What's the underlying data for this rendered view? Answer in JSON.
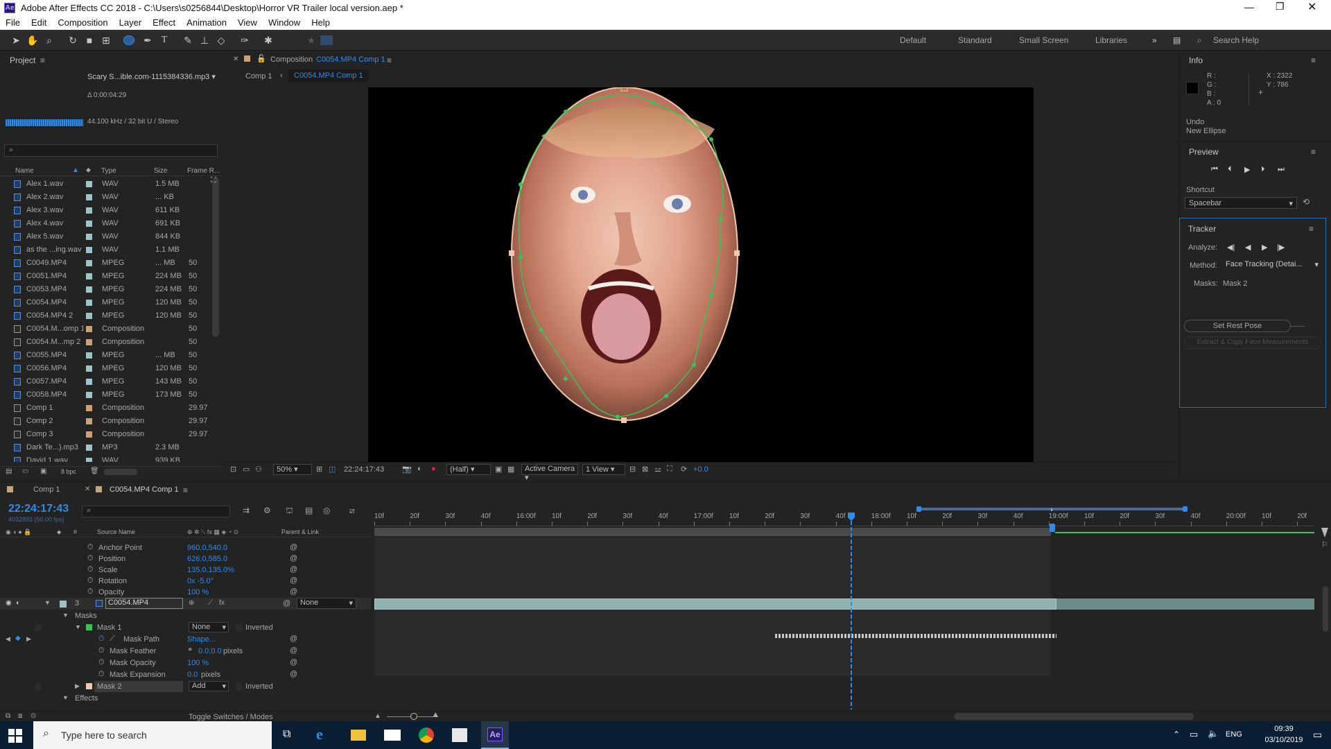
{
  "window": {
    "title": "Adobe After Effects CC 2018 - C:\\Users\\s0256844\\Desktop\\Horror VR Trailer local version.aep *"
  },
  "menu": [
    "File",
    "Edit",
    "Composition",
    "Layer",
    "Effect",
    "Animation",
    "View",
    "Window",
    "Help"
  ],
  "workspaces": [
    "Default",
    "Standard",
    "Small Screen",
    "Libraries"
  ],
  "search_help": "Search Help",
  "project": {
    "title": "Project",
    "selected_name": "Scary S...ible.com-1115384336.mp3 ▾",
    "duration": "Δ 0:00:04:29",
    "audio_info": "44.100 kHz / 32 bit U / Stereo",
    "search_placeholder": "",
    "columns": {
      "name": "Name",
      "type": "Type",
      "size": "Size",
      "frame": "Frame R..."
    },
    "items": [
      {
        "name": "Alex 1.wav",
        "type": "WAV",
        "size": "1.5 MB",
        "frame": "",
        "kind": "audio",
        "label": "#9fc4c8"
      },
      {
        "name": "Alex 2.wav",
        "type": "WAV",
        "size": "... KB",
        "frame": "",
        "kind": "audio",
        "label": "#9fc4c8"
      },
      {
        "name": "Alex 3.wav",
        "type": "WAV",
        "size": "611 KB",
        "frame": "",
        "kind": "audio",
        "label": "#9fc4c8"
      },
      {
        "name": "Alex 4.wav",
        "type": "WAV",
        "size": "691 KB",
        "frame": "",
        "kind": "audio",
        "label": "#9fc4c8"
      },
      {
        "name": "Alex 5.wav",
        "type": "WAV",
        "size": "844 KB",
        "frame": "",
        "kind": "audio",
        "label": "#9fc4c8"
      },
      {
        "name": "as the ...ing.wav",
        "type": "WAV",
        "size": "1.1 MB",
        "frame": "",
        "kind": "audio",
        "label": "#9fc4c8"
      },
      {
        "name": "C0049.MP4",
        "type": "MPEG",
        "size": "... MB",
        "frame": "50",
        "kind": "video",
        "label": "#9fc4c8"
      },
      {
        "name": "C0051.MP4",
        "type": "MPEG",
        "size": "224 MB",
        "frame": "50",
        "kind": "video",
        "label": "#9fc4c8"
      },
      {
        "name": "C0053.MP4",
        "type": "MPEG",
        "size": "224 MB",
        "frame": "50",
        "kind": "video",
        "label": "#9fc4c8"
      },
      {
        "name": "C0054.MP4",
        "type": "MPEG",
        "size": "120 MB",
        "frame": "50",
        "kind": "video",
        "label": "#9fc4c8"
      },
      {
        "name": "C0054.MP4 2",
        "type": "MPEG",
        "size": "120 MB",
        "frame": "50",
        "kind": "video",
        "label": "#9fc4c8"
      },
      {
        "name": "C0054.M...omp 1",
        "type": "Composition",
        "size": "",
        "frame": "50",
        "kind": "comp",
        "label": "#c8a27a"
      },
      {
        "name": "C0054.M...mp 2",
        "type": "Composition",
        "size": "",
        "frame": "50",
        "kind": "comp",
        "label": "#c8a27a"
      },
      {
        "name": "C0055.MP4",
        "type": "MPEG",
        "size": "... MB",
        "frame": "50",
        "kind": "video",
        "label": "#9fc4c8"
      },
      {
        "name": "C0056.MP4",
        "type": "MPEG",
        "size": "120 MB",
        "frame": "50",
        "kind": "video",
        "label": "#9fc4c8"
      },
      {
        "name": "C0057.MP4",
        "type": "MPEG",
        "size": "143 MB",
        "frame": "50",
        "kind": "video",
        "label": "#9fc4c8"
      },
      {
        "name": "C0058.MP4",
        "type": "MPEG",
        "size": "173 MB",
        "frame": "50",
        "kind": "video",
        "label": "#9fc4c8"
      },
      {
        "name": "Comp 1",
        "type": "Composition",
        "size": "",
        "frame": "29.97",
        "kind": "comp",
        "label": "#c8a27a"
      },
      {
        "name": "Comp 2",
        "type": "Composition",
        "size": "",
        "frame": "29.97",
        "kind": "comp",
        "label": "#c8a27a"
      },
      {
        "name": "Comp 3",
        "type": "Composition",
        "size": "",
        "frame": "29.97",
        "kind": "comp",
        "label": "#c8a27a"
      },
      {
        "name": "Dark Te...).mp3",
        "type": "MP3",
        "size": "2.3 MB",
        "frame": "",
        "kind": "audio",
        "label": "#9fc4c8"
      },
      {
        "name": "David 1.wav",
        "type": "WAV",
        "size": "939 KB",
        "frame": "",
        "kind": "audio",
        "label": "#9fc4c8"
      }
    ],
    "bpc": "8 bpc"
  },
  "composition": {
    "panel_label": "Composition",
    "panel_name": "C0054.MP4 Comp 1",
    "breadcrumbs": [
      "Comp 1",
      "C0054.MP4 Comp 1"
    ],
    "zoom": "50%",
    "timecode": "22:24:17:43",
    "resolution": "(Half)",
    "camera": "Active Camera",
    "views": "1 View",
    "exposure": "+0.0"
  },
  "info": {
    "title": "Info",
    "r": "R :",
    "g": "G :",
    "b": "B :",
    "a": "A : 0",
    "x": "X : 2322",
    "y": "Y : 786",
    "undo_label": "Undo",
    "undo_value": "New Ellipse"
  },
  "preview": {
    "title": "Preview",
    "shortcut_label": "Shortcut",
    "shortcut_value": "Spacebar"
  },
  "tracker": {
    "title": "Tracker",
    "analyze_label": "Analyze:",
    "method_label": "Method:",
    "method_value": "Face Tracking (Detai...",
    "masks_label": "Masks:",
    "masks_value": "Mask 2",
    "set_rest_pose": "Set Rest Pose",
    "extract": "Extract & Copy Face Measurements"
  },
  "timeline": {
    "tabs": [
      "Comp 1",
      "C0054.MP4 Comp 1"
    ],
    "timecode": "22:24:17:43",
    "frames": "4032893 (50.00 fps)",
    "col_source": "Source Name",
    "col_parent": "Parent & Link",
    "ruler": [
      "10f",
      "20f",
      "30f",
      "40f",
      "16:00f",
      "10f",
      "20f",
      "30f",
      "40f",
      "17:00f",
      "10f",
      "20f",
      "30f",
      "40f",
      "18:00f",
      "10f",
      "20f",
      "30f",
      "40f",
      "19:00f",
      "10f",
      "20f",
      "30f",
      "40f",
      "20:00f",
      "10f",
      "20f"
    ],
    "props": [
      {
        "name": "Anchor Point",
        "value": "960.0,540.0"
      },
      {
        "name": "Position",
        "value": "626.0,585.0"
      },
      {
        "name": "Scale",
        "value": "135.0,135.0%"
      },
      {
        "name": "Rotation",
        "value": "0x -5.0°"
      },
      {
        "name": "Opacity",
        "value": "100 %"
      }
    ],
    "layer": {
      "index": "3",
      "name": "C0054.MP4",
      "parent": "None"
    },
    "masks_group": "Masks",
    "mask1": {
      "name": "Mask 1",
      "mode": "None",
      "inverted": "Inverted"
    },
    "mask_props": [
      {
        "name": "Mask Path",
        "value": "Shape...",
        "unit": ""
      },
      {
        "name": "Mask Feather",
        "value": "0.0,0.0",
        "unit": "pixels"
      },
      {
        "name": "Mask Opacity",
        "value": "100 %",
        "unit": ""
      },
      {
        "name": "Mask Expansion",
        "value": "0.0",
        "unit": "pixels"
      }
    ],
    "mask2": {
      "name": "Mask 2",
      "mode": "Add",
      "inverted": "Inverted"
    },
    "effects": "Effects",
    "toggle": "Toggle Switches / Modes"
  },
  "taskbar": {
    "search_placeholder": "Type here to search",
    "lang": "ENG",
    "time": "09:39",
    "date": "03/10/2019"
  },
  "colors": {
    "accent": "#2d8ceb",
    "panel": "#232323",
    "layerbar": "#8fb3b0",
    "maskpath": "#39c45a"
  }
}
